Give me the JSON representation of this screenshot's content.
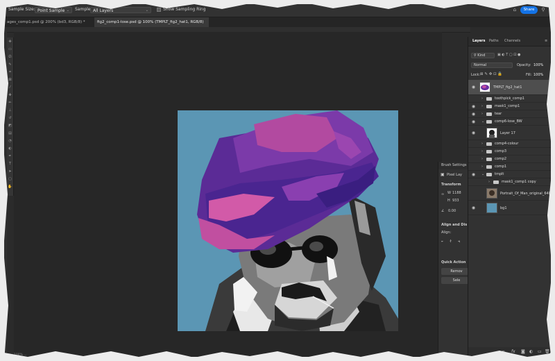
{
  "options_bar": {
    "sample_size_label": "Sample Size:",
    "sample_size_value": "Point Sample",
    "sample_label": "Sample:",
    "sample_value": "All Layers",
    "sampling_ring_label": "Show Sampling Ring",
    "share_label": "Share"
  },
  "tabs": [
    {
      "label": "ages_comp1.psd @ 200% (bd3, RGB/8) *"
    },
    {
      "label": "fig2_comp1-lose.psd @ 100% (TMPLT_fig2_hat1, RGB/8)"
    }
  ],
  "status_text": "100% ...",
  "brush_panel": {
    "title": "Brush Settings",
    "pixel_layer": "Pixel Lay",
    "transform": "Transform",
    "w_label": "W",
    "w_value": "1188",
    "h_label": "H",
    "h_value": "933",
    "angle_value": "0.00",
    "align_title": "Align and Dis",
    "align_label": "Align:",
    "quick_actions": "Quick Action",
    "remove_btn": "Remov",
    "select_btn": "Sele"
  },
  "layers_panel": {
    "tabs": [
      "Layers",
      "Paths",
      "Channels"
    ],
    "kind_label": "Kind",
    "blend_mode": "Normal",
    "opacity_label": "Opacity:",
    "opacity_value": "100%",
    "lock_label": "Lock:",
    "fill_label": "Fill:",
    "fill_value": "100%",
    "layers": [
      {
        "name": "TMPLT_fig2_hat1",
        "type": "pixel",
        "selected": true
      },
      {
        "name": "toothpick_comp1",
        "type": "group"
      },
      {
        "name": "mask1_comp1",
        "type": "group"
      },
      {
        "name": "tear",
        "type": "group"
      },
      {
        "name": "comp6-lose_BW",
        "type": "group-open"
      },
      {
        "name": "Layer 17",
        "type": "pixel-bw"
      },
      {
        "name": "comp4-colour",
        "type": "group"
      },
      {
        "name": "comp3",
        "type": "group"
      },
      {
        "name": "comp2",
        "type": "group"
      },
      {
        "name": "comp1",
        "type": "group"
      },
      {
        "name": "tmplt",
        "type": "group-open"
      },
      {
        "name": "mask1_comp1 copy",
        "type": "group-nested"
      },
      {
        "name": "Portrait_Of_Man_original_640",
        "type": "photo"
      },
      {
        "name": "bg1",
        "type": "fill"
      }
    ],
    "footer_icons": [
      "link-icon",
      "fx-icon",
      "mask-icon",
      "adjustment-icon",
      "folder-icon",
      "new-layer-icon",
      "trash-icon"
    ]
  },
  "colors": {
    "accent": "#1473e6",
    "canvas_bg": "#5b96b4",
    "hat_purple": "#6a2fa3",
    "hat_pink": "#c24aa0"
  }
}
